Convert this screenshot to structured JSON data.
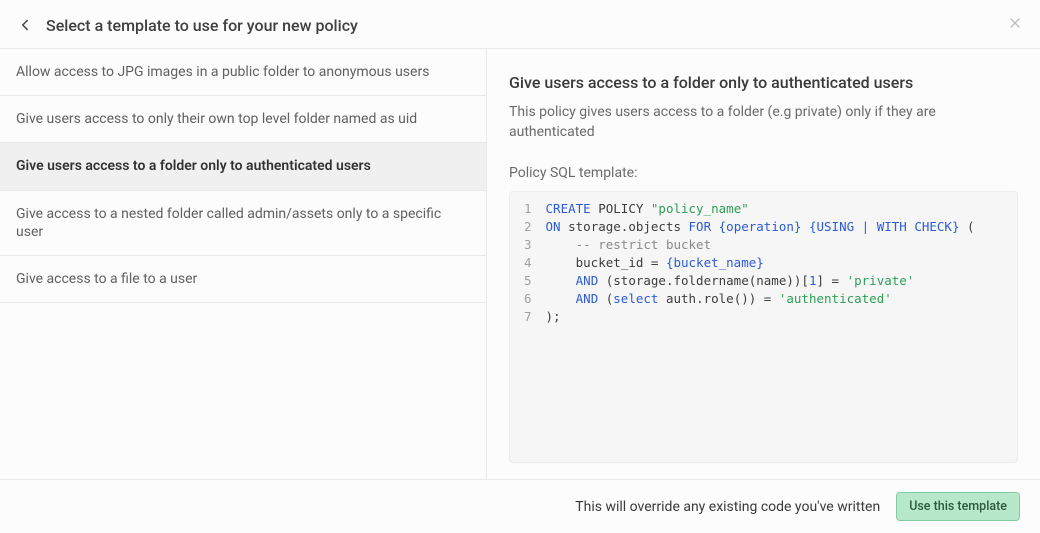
{
  "header": {
    "title": "Select a template to use for your new policy"
  },
  "templates": [
    {
      "label": "Allow access to JPG images in a public folder to anonymous users",
      "selected": false
    },
    {
      "label": "Give users access to only their own top level folder named as uid",
      "selected": false
    },
    {
      "label": "Give users access to a folder only to authenticated users",
      "selected": true
    },
    {
      "label": "Give access to a nested folder called admin/assets only to a specific user",
      "selected": false
    },
    {
      "label": "Give access to a file to a user",
      "selected": false
    }
  ],
  "preview": {
    "title": "Give users access to a folder only to authenticated users",
    "description": "This policy gives users access to a folder (e.g private) only if they are authenticated",
    "sql_label": "Policy SQL template:",
    "sql_lines": 7,
    "sql": {
      "policy_name": "policy_name",
      "operation_ph": "{operation}",
      "using_check_ph": "{USING | WITH CHECK}",
      "bucket_ph": "{bucket_name}",
      "comment": "-- restrict bucket",
      "folder_literal": "'private'",
      "role_literal": "'authenticated'",
      "index_literal": "1"
    }
  },
  "footer": {
    "note": "This will override any existing code you've written",
    "button": "Use this template"
  }
}
